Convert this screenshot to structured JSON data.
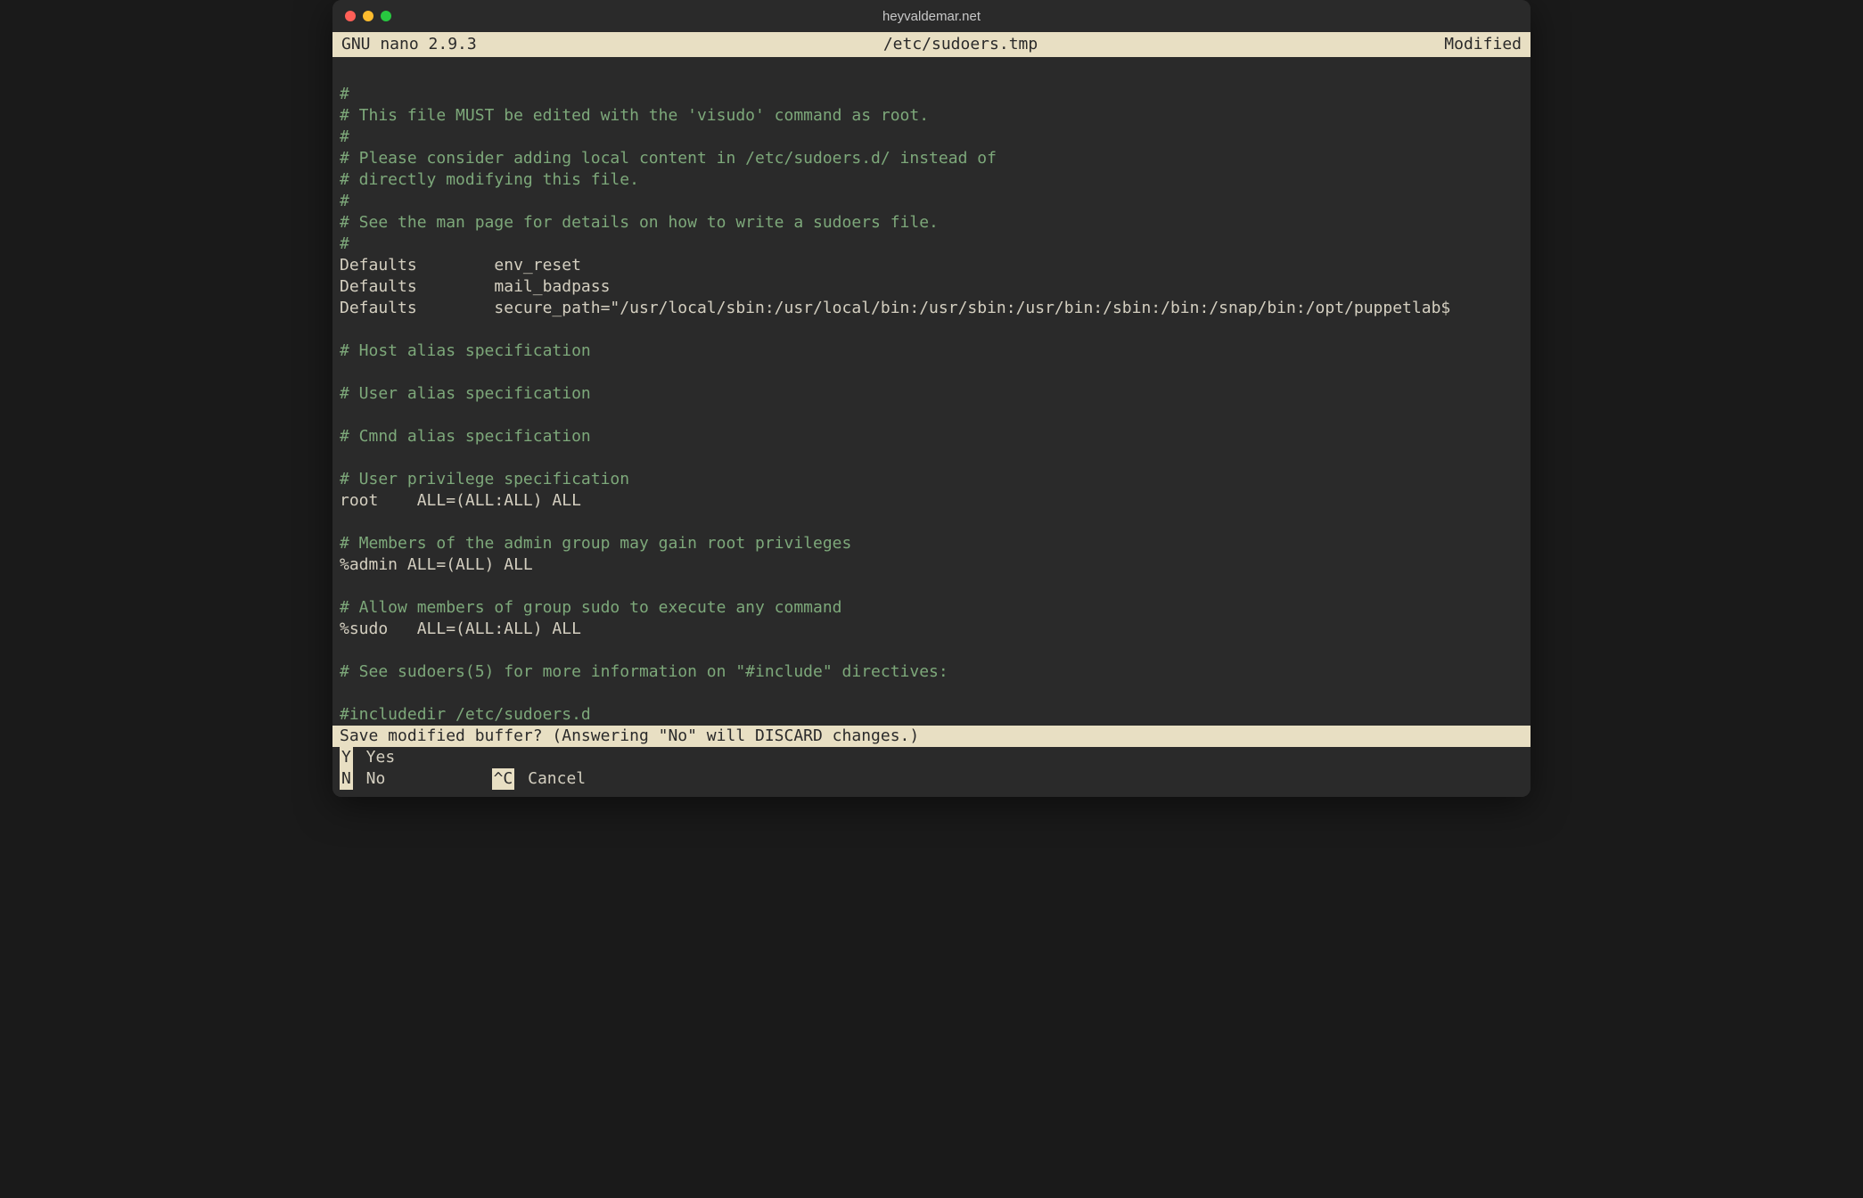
{
  "window": {
    "title": "heyvaldemar.net"
  },
  "nano": {
    "app_version": "  GNU nano 2.9.3",
    "file_path": "/etc/sudoers.tmp",
    "status": "Modified  "
  },
  "editor": {
    "lines": [
      {
        "cls": "comment",
        "text": "#"
      },
      {
        "cls": "comment",
        "text": "# This file MUST be edited with the 'visudo' command as root."
      },
      {
        "cls": "comment",
        "text": "#"
      },
      {
        "cls": "comment",
        "text": "# Please consider adding local content in /etc/sudoers.d/ instead of"
      },
      {
        "cls": "comment",
        "text": "# directly modifying this file."
      },
      {
        "cls": "comment",
        "text": "#"
      },
      {
        "cls": "comment",
        "text": "# See the man page for details on how to write a sudoers file."
      },
      {
        "cls": "comment",
        "text": "#"
      },
      {
        "cls": "plain",
        "text": "Defaults        env_reset"
      },
      {
        "cls": "plain",
        "text": "Defaults        mail_badpass"
      },
      {
        "cls": "plain",
        "text": "Defaults        secure_path=\"/usr/local/sbin:/usr/local/bin:/usr/sbin:/usr/bin:/sbin:/bin:/snap/bin:/opt/puppetlab$"
      },
      {
        "cls": "plain",
        "text": ""
      },
      {
        "cls": "comment",
        "text": "# Host alias specification"
      },
      {
        "cls": "plain",
        "text": ""
      },
      {
        "cls": "comment",
        "text": "# User alias specification"
      },
      {
        "cls": "plain",
        "text": ""
      },
      {
        "cls": "comment",
        "text": "# Cmnd alias specification"
      },
      {
        "cls": "plain",
        "text": ""
      },
      {
        "cls": "comment",
        "text": "# User privilege specification"
      },
      {
        "cls": "plain",
        "text": "root    ALL=(ALL:ALL) ALL"
      },
      {
        "cls": "plain",
        "text": ""
      },
      {
        "cls": "comment",
        "text": "# Members of the admin group may gain root privileges"
      },
      {
        "cls": "plain",
        "text": "%admin ALL=(ALL) ALL"
      },
      {
        "cls": "plain",
        "text": ""
      },
      {
        "cls": "comment",
        "text": "# Allow members of group sudo to execute any command"
      },
      {
        "cls": "plain",
        "text": "%sudo   ALL=(ALL:ALL) ALL"
      },
      {
        "cls": "plain",
        "text": ""
      },
      {
        "cls": "comment",
        "text": "# See sudoers(5) for more information on \"#include\" directives:"
      },
      {
        "cls": "plain",
        "text": ""
      },
      {
        "cls": "comment",
        "text": "#includedir /etc/sudoers.d"
      }
    ]
  },
  "prompt": {
    "question": "Save modified buffer?  (Answering \"No\" will DISCARD changes.)"
  },
  "shortcuts": {
    "yes_key": " Y",
    "yes_label": " Yes",
    "no_key": " N",
    "no_label": " No",
    "cancel_key": "^C",
    "cancel_label": " Cancel",
    "gap": "           "
  }
}
